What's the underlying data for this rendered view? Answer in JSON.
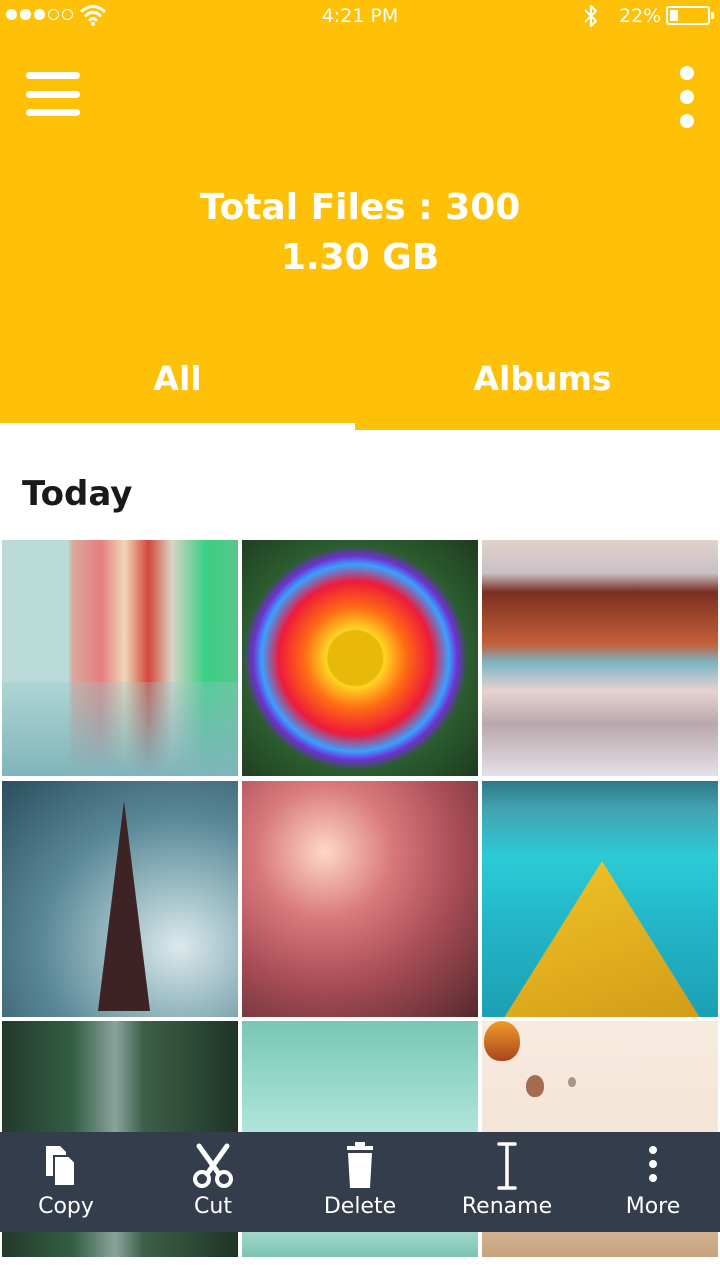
{
  "status_bar": {
    "time": "4:21 PM",
    "battery_percent": "22%",
    "battery_level": 0.22,
    "signal_dots_filled": 3,
    "signal_dots_total": 5
  },
  "header": {
    "total_files": "Total Files : 300",
    "size": "1.30 GB",
    "background_color": "#ffc107"
  },
  "tabs": [
    {
      "label": "All",
      "selected": true
    },
    {
      "label": "Albums",
      "selected": false
    }
  ],
  "section": {
    "title": "Today"
  },
  "images": [
    {
      "name": "colorful-harbor-houses"
    },
    {
      "name": "rainbow-daisy"
    },
    {
      "name": "mountain-lake-reflection"
    },
    {
      "name": "eiffel-tower"
    },
    {
      "name": "sprout-in-glass"
    },
    {
      "name": "yellow-boat"
    },
    {
      "name": "forest-road"
    },
    {
      "name": "teal-lake-bird"
    },
    {
      "name": "hot-air-balloons"
    }
  ],
  "actions": [
    {
      "label": "Copy",
      "icon": "copy-icon"
    },
    {
      "label": "Cut",
      "icon": "scissors-icon"
    },
    {
      "label": "Delete",
      "icon": "trash-icon"
    },
    {
      "label": "Rename",
      "icon": "text-cursor-icon"
    },
    {
      "label": "More",
      "icon": "more-vertical-icon"
    }
  ]
}
